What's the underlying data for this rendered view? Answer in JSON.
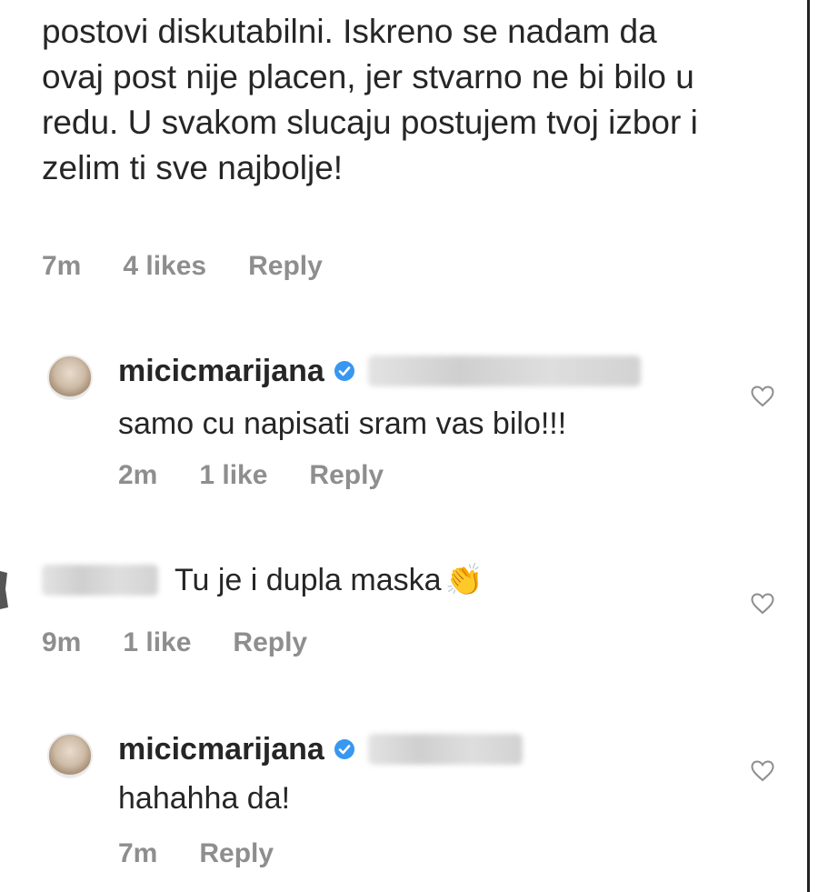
{
  "comments": [
    {
      "text": "postovi diskutabilni. Iskreno se nadam da ovaj post nije placen, jer stvarno ne bi bilo u redu. U svakom slucaju postujem tvoj izbor i zelim ti sve najbolje!",
      "time": "7m",
      "likes": "4 likes",
      "reply": "Reply"
    },
    {
      "username": "micicmarijana",
      "text": "samo cu napisati sram vas bilo!!!",
      "time": "2m",
      "likes": "1 like",
      "reply": "Reply"
    },
    {
      "text": "Tu je i dupla maska",
      "emoji": "👏",
      "time": "9m",
      "likes": "1 like",
      "reply": "Reply"
    },
    {
      "username": "micicmarijana",
      "text": "hahahha da!",
      "time": "7m",
      "reply": "Reply"
    }
  ],
  "icons": {
    "verified": "verified-badge-icon",
    "heart": "heart-icon",
    "avatar": "avatar"
  },
  "colors": {
    "verified": "#3897f0",
    "meta": "#8e8e8e",
    "text": "#262626"
  }
}
